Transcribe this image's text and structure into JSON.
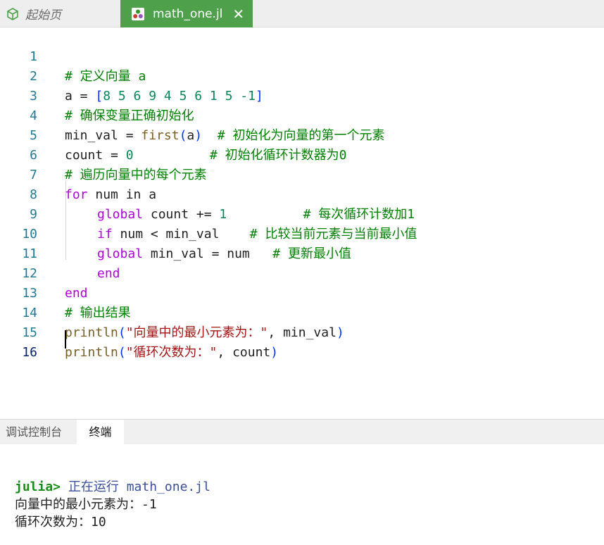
{
  "tabs": {
    "home_label": "起始页",
    "file_label": "math_one.jl",
    "close_glyph": "✕"
  },
  "editor": {
    "line_numbers": [
      "1",
      "2",
      "3",
      "4",
      "5",
      "6",
      "7",
      "8",
      "9",
      "10",
      "11",
      "12",
      "13",
      "14",
      "15",
      "16"
    ],
    "lines": [
      {
        "comment": "# 定义向量 a"
      },
      {
        "t1": "a = ",
        "bracket_open": "[",
        "nums": "8 5 6 9 4 5 6 1 5 -1",
        "bracket_close": "]"
      },
      {
        "comment": "# 确保变量正确初始化"
      },
      {
        "t1": "min_val = ",
        "fn": "first",
        "paren_open": "(",
        "arg": "a",
        "paren_close": ")",
        "gap": "  ",
        "comment": "# 初始化为向量的第一个元素"
      },
      {
        "t1": "count = ",
        "num": "0",
        "gap": "          ",
        "comment": "# 初始化循环计数器为0"
      },
      {
        "comment": "# 遍历向量中的每个元素"
      },
      {
        "kw": "for",
        "t1": " num in a"
      },
      {
        "kw": "global",
        "t1": " count += ",
        "num": "1",
        "gap": "          ",
        "comment": "# 每次循环计数加1"
      },
      {
        "kw": "if",
        "t1": " num < min_val    ",
        "comment": "# 比较当前元素与当前最小值"
      },
      {
        "kw": "global",
        "t1": " min_val = num   ",
        "comment": "# 更新最小值"
      },
      {
        "kw": "end"
      },
      {
        "kw": "end"
      },
      {
        "comment": "# 输出结果"
      },
      {
        "fn": "println",
        "paren_open": "(",
        "str": "\"向量中的最小元素为：\"",
        "t1": ", min_val",
        "paren_close": ")"
      },
      {
        "fn": "println",
        "paren_open": "(",
        "str": "\"循环次数为：\"",
        "t1": ", count",
        "paren_close": ")"
      },
      {}
    ]
  },
  "panel": {
    "tab_debug": "调试控制台",
    "tab_terminal": "终端"
  },
  "terminal": {
    "prompt": "julia>",
    "running_text": " 正在运行 math_one.jl",
    "output_1": "向量中的最小元素为：-1",
    "output_2": "循环次数为：10"
  },
  "colors": {
    "active_tab": "#4ea14a",
    "line_number": "#237893",
    "keyword": "#af00db",
    "comment": "#008000",
    "number": "#098658",
    "function": "#795e26",
    "string": "#a31515",
    "prompt": "#198d19"
  }
}
